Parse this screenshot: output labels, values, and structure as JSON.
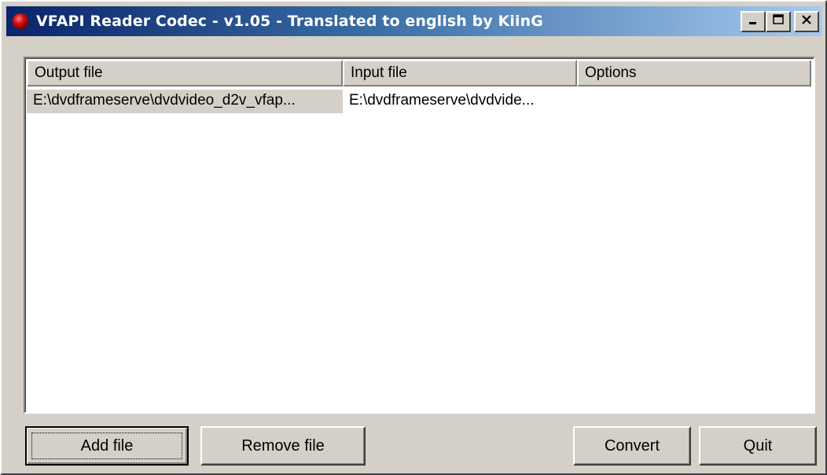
{
  "window": {
    "title": "VFAPI Reader Codec - v1.05 - Translated to english by KiinG",
    "icon": "red-sphere-icon",
    "controls": [
      "minimize",
      "maximize",
      "close"
    ]
  },
  "list": {
    "columns": [
      "Output file",
      "Input file",
      "Options"
    ],
    "rows": [
      {
        "output": "E:\\dvdframeserve\\dvdvideo_d2v_vfap...",
        "input": "E:\\dvdframeserve\\dvdvide...",
        "options": ""
      }
    ]
  },
  "buttons": {
    "add": "Add file",
    "remove": "Remove file",
    "convert": "Convert",
    "quit": "Quit"
  },
  "colors": {
    "title_gradient_start": "#0a246a",
    "title_gradient_end": "#a6caf0",
    "face": "#d4d0c8",
    "icon_red": "#e01010"
  }
}
